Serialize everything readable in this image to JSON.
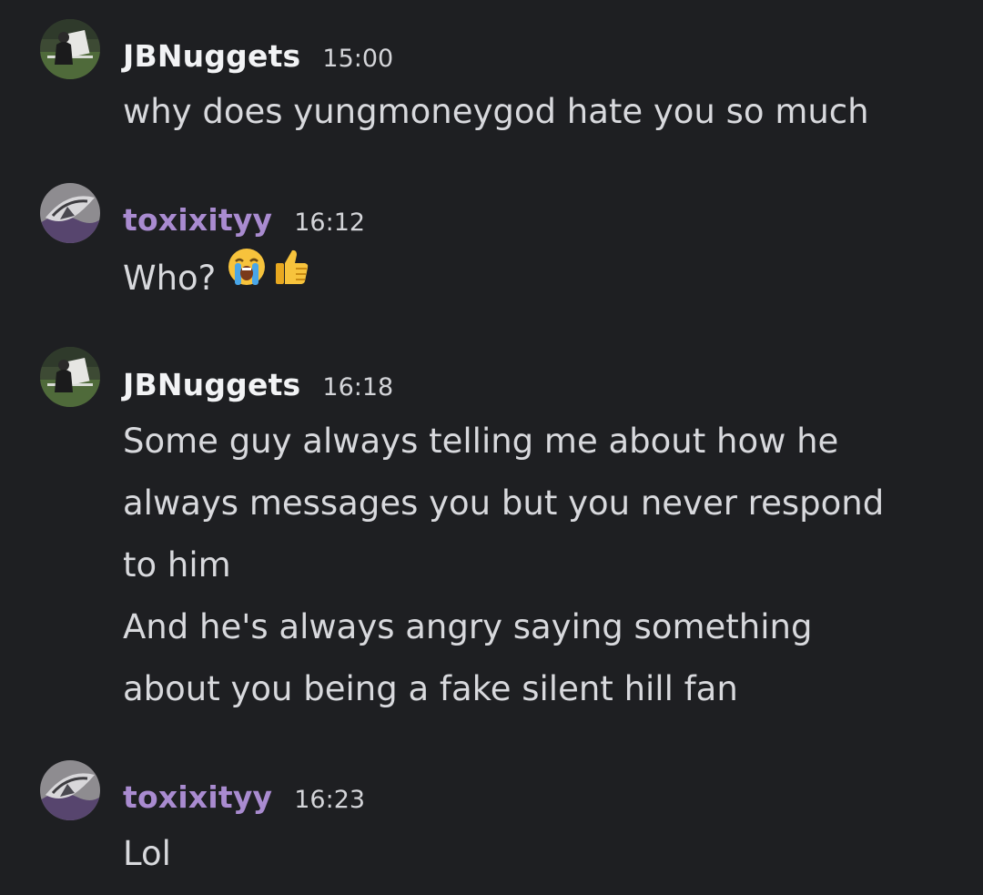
{
  "colors": {
    "background": "#1e1f22",
    "jbnuggets_name": "#f2f3f5",
    "toxixityy_name": "#a98bd0",
    "timestamp": "#d4d5d9",
    "message_text": "#d8d9dd"
  },
  "messages": [
    {
      "username": "JBNuggets",
      "timestamp": "15:00",
      "avatar_icon": "jbnuggets-avatar",
      "lines": [
        "why does yungmoneygod hate you so much"
      ]
    },
    {
      "username": "toxixityy",
      "timestamp": "16:12",
      "avatar_icon": "toxixityy-avatar",
      "lines": [
        "Who?"
      ],
      "emojis": [
        "loudly-crying-face-icon",
        "thumbs-up-icon"
      ]
    },
    {
      "username": "JBNuggets",
      "timestamp": "16:18",
      "avatar_icon": "jbnuggets-avatar",
      "lines": [
        "Some guy always telling me about how he",
        "always messages you but you never respond",
        "to him",
        "And he's always angry saying something",
        "about you being a fake silent hill fan"
      ]
    },
    {
      "username": "toxixityy",
      "timestamp": "16:23",
      "avatar_icon": "toxixityy-avatar",
      "lines": [
        "Lol"
      ]
    }
  ]
}
